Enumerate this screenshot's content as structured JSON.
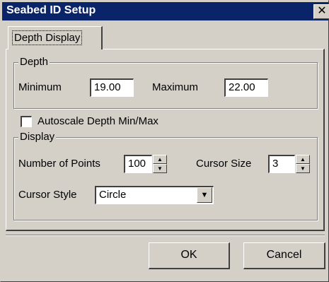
{
  "window": {
    "title": "Seabed ID Setup",
    "close_symbol": "✕"
  },
  "tabs": [
    {
      "label": "Depth Display",
      "selected": true
    }
  ],
  "depth_group": {
    "legend": "Depth",
    "minimum_label": "Minimum",
    "minimum_value": "19.00",
    "maximum_label": "Maximum",
    "maximum_value": "22.00"
  },
  "autoscale": {
    "label": "Autoscale Depth Min/Max",
    "checked": false
  },
  "display_group": {
    "legend": "Display",
    "points_label": "Number of Points",
    "points_value": "100",
    "cursor_size_label": "Cursor Size",
    "cursor_size_value": "3",
    "cursor_style_label": "Cursor Style",
    "cursor_style_value": "Circle"
  },
  "buttons": {
    "ok": "OK",
    "cancel": "Cancel"
  },
  "colors": {
    "titlebar": "#0a246a",
    "face": "#d4d0c8"
  }
}
